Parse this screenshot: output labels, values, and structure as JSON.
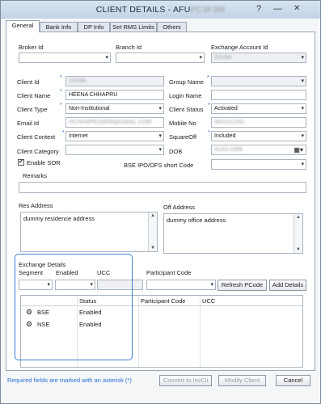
{
  "window": {
    "title": "CLIENT DETAILS - AFU",
    "title_blurred": "PC3F3M",
    "buttons": {
      "help": "?",
      "minimize": "—",
      "close": "✕"
    }
  },
  "tabs": [
    {
      "label": "General"
    },
    {
      "label": "Bank Info"
    },
    {
      "label": "DP Info"
    },
    {
      "label": "Set RMS Limits"
    },
    {
      "label": "Others"
    }
  ],
  "fields": {
    "broker_id": {
      "label": "Broker Id",
      "value": ""
    },
    "branch_id": {
      "label": "Branch Id",
      "value": ""
    },
    "exchange_account_id": {
      "label": "Exchange Account Id",
      "value": "Z4V9A"
    },
    "client_id": {
      "label": "Client Id",
      "value": "Z4V9A"
    },
    "client_name": {
      "label": "Client Name",
      "value": "HEENA CHHAPRU"
    },
    "client_type": {
      "label": "Client Type",
      "value": "Non-Institutional"
    },
    "email_id": {
      "label": "Email Id",
      "value": "HCHHAPRU0508@GMAIL.COM"
    },
    "client_context": {
      "label": "Client Context",
      "value": "Internet"
    },
    "client_category": {
      "label": "Client Category",
      "value": ""
    },
    "enable_sor": {
      "label": "Enable SOR",
      "checked": "✔"
    },
    "group_name": {
      "label": "Group Name",
      "value": ""
    },
    "login_name": {
      "label": "Login Name",
      "value": ""
    },
    "client_status": {
      "label": "Client Status",
      "value": "Activated"
    },
    "mobile_no": {
      "label": "Mobile No",
      "value": "98XXX1281"
    },
    "squareoff": {
      "label": "SquareOff",
      "value": "Included"
    },
    "dob": {
      "label": "DOB",
      "value": "01/01/1996"
    },
    "bse_ipo_short": {
      "label": "BSE IPO/OFS short Code",
      "value": ""
    },
    "remarks": {
      "label": "Remarks",
      "value": ""
    },
    "res_address": {
      "label": "Res Address",
      "value": "dummy residence address"
    },
    "off_address": {
      "label": "Off Address",
      "value": "dummy office address"
    }
  },
  "exchange": {
    "heading": "Exchange Details",
    "segment_label": "Segment",
    "enabled_label": "Enabled",
    "ucc_label": "UCC",
    "participant_label": "Participant Code",
    "refresh_button": "Refresh PCode",
    "add_button": "Add Details",
    "columns": [
      "Status",
      "Participant Code",
      "UCC"
    ],
    "rows": [
      {
        "segment": "BSE",
        "status": "Enabled",
        "icon": "exchange-icon"
      },
      {
        "segment": "NSE",
        "status": "Enabled",
        "icon": "exchange-icon"
      }
    ]
  },
  "footer": {
    "note": "Required fields are marked with an asterisk (*)",
    "convert_button": "Convert to InvCli",
    "modify_button": "Modify Client",
    "cancel_button": "Cancel"
  },
  "colors": {
    "accent": "#2a6fd6",
    "highlight_box": "#3b7fd6"
  }
}
